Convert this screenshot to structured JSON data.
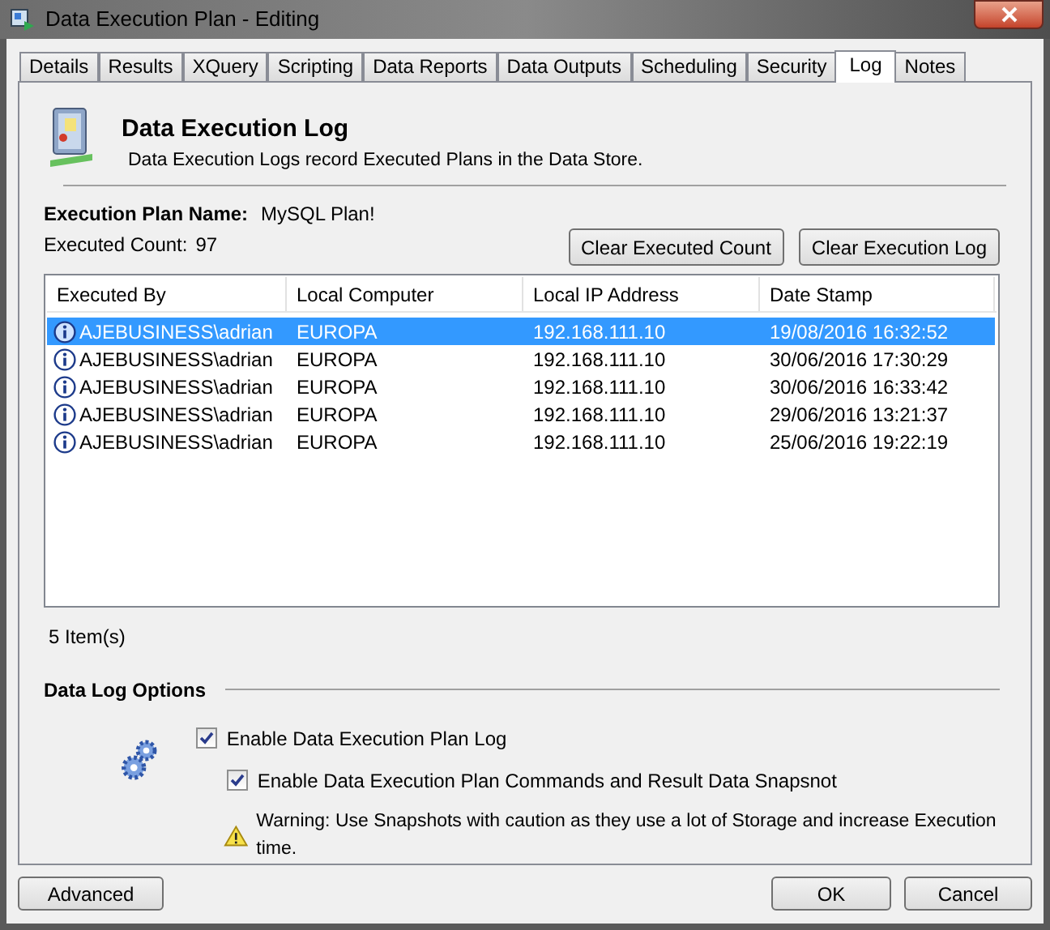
{
  "window": {
    "title": "Data Execution Plan - Editing"
  },
  "tabs": [
    {
      "label": "Details",
      "selected": false
    },
    {
      "label": "Results",
      "selected": false
    },
    {
      "label": "XQuery",
      "selected": false
    },
    {
      "label": "Scripting",
      "selected": false
    },
    {
      "label": "Data Reports",
      "selected": false
    },
    {
      "label": "Data Outputs",
      "selected": false
    },
    {
      "label": "Scheduling",
      "selected": false
    },
    {
      "label": "Security",
      "selected": false
    },
    {
      "label": "Log",
      "selected": true
    },
    {
      "label": "Notes",
      "selected": false
    }
  ],
  "header": {
    "title": "Data Execution Log",
    "subtitle": "Data Execution Logs record Executed Plans in the Data Store."
  },
  "plan_name": {
    "label": "Execution Plan Name:",
    "value": "MySQL Plan!"
  },
  "executed_count": {
    "label": "Executed Count:",
    "value": "97"
  },
  "actions": [
    "Clear Executed Count",
    "Clear Execution Log"
  ],
  "table": {
    "columns": [
      "Executed By",
      "Local Computer",
      "Local IP Address",
      "Date Stamp"
    ],
    "rows": [
      {
        "selected": true,
        "cells": [
          "AJEBUSINESS\\adrian",
          "EUROPA",
          "192.168.111.10",
          "19/08/2016 16:32:52"
        ]
      },
      {
        "selected": false,
        "cells": [
          "AJEBUSINESS\\adrian",
          "EUROPA",
          "192.168.111.10",
          "30/06/2016 17:30:29"
        ]
      },
      {
        "selected": false,
        "cells": [
          "AJEBUSINESS\\adrian",
          "EUROPA",
          "192.168.111.10",
          "30/06/2016 16:33:42"
        ]
      },
      {
        "selected": false,
        "cells": [
          "AJEBUSINESS\\adrian",
          "EUROPA",
          "192.168.111.10",
          "29/06/2016 13:21:37"
        ]
      },
      {
        "selected": false,
        "cells": [
          "AJEBUSINESS\\adrian",
          "EUROPA",
          "192.168.111.10",
          "25/06/2016 19:22:19"
        ]
      }
    ]
  },
  "item_count": "5 Item(s)",
  "options": {
    "title": "Data Log Options",
    "checkboxes": [
      {
        "label": "Enable Data Execution Plan Log",
        "checked": true
      },
      {
        "label": "Enable Data Execution Plan Commands and Result Data Snapsnot",
        "checked": true
      }
    ],
    "warning": "Warning: Use Snapshots with caution as they use a lot of Storage and increase Execution time."
  },
  "buttons": {
    "left": "Advanced",
    "ok": "OK",
    "cancel": "Cancel"
  }
}
